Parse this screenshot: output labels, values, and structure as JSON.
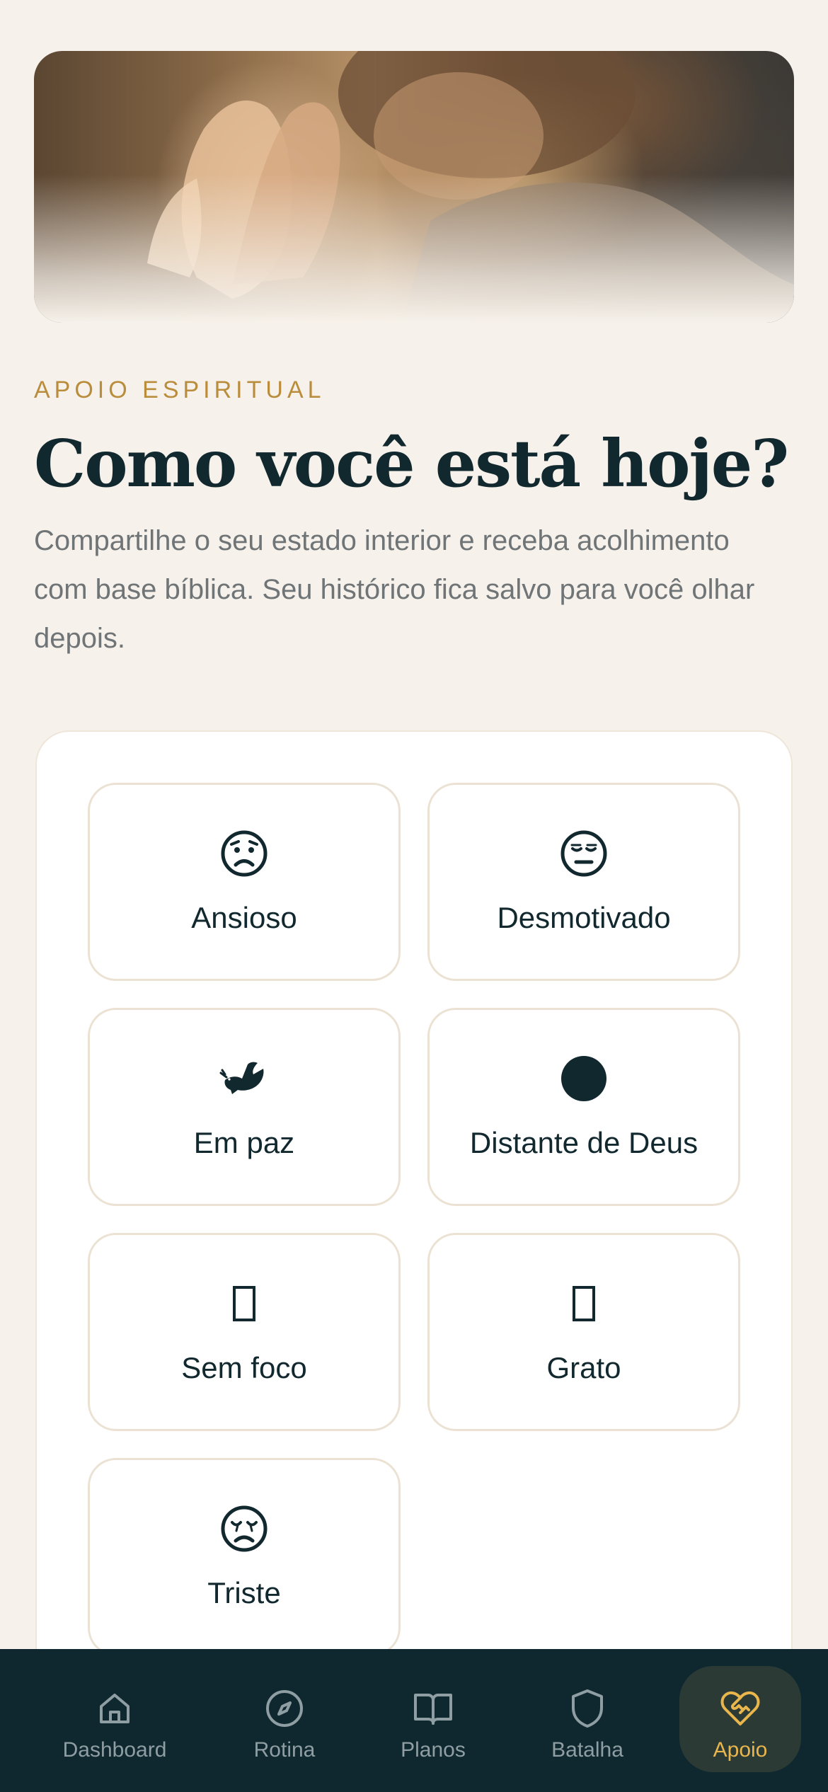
{
  "header": {
    "eyebrow": "APOIO ESPIRITUAL",
    "title": "Como você está hoje?",
    "subtitle": "Compartilhe o seu estado interior e receba acolhimento com base bíblica. Seu histórico fica salvo para você olhar depois."
  },
  "moods": [
    {
      "label": "Ansioso",
      "icon": "worried-face-icon"
    },
    {
      "label": "Desmotivado",
      "icon": "neutral-face-icon"
    },
    {
      "label": "Em paz",
      "icon": "dove-icon"
    },
    {
      "label": "Distante de Deus",
      "icon": "filled-circle-icon"
    },
    {
      "label": "Sem foco",
      "icon": "missing-glyph-icon"
    },
    {
      "label": "Grato",
      "icon": "missing-glyph-icon"
    },
    {
      "label": "Triste",
      "icon": "sad-face-icon"
    }
  ],
  "nav": {
    "items": [
      {
        "label": "Dashboard",
        "icon": "home-icon"
      },
      {
        "label": "Rotina",
        "icon": "compass-icon"
      },
      {
        "label": "Planos",
        "icon": "book-icon"
      },
      {
        "label": "Batalha",
        "icon": "shield-icon"
      },
      {
        "label": "Apoio",
        "icon": "heart-handshake-icon",
        "active": true
      }
    ],
    "active_color": "#e8b64c",
    "inactive_color": "#8e9ea2"
  },
  "colors": {
    "background": "#f6f1ea",
    "accent": "#b98d3c",
    "title": "#12282f",
    "nav_background": "#0f2830"
  }
}
